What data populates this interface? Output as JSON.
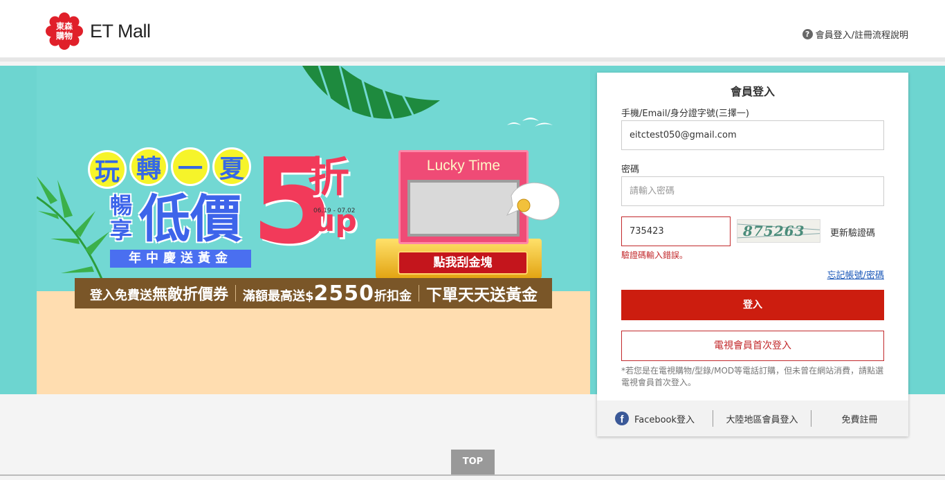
{
  "header": {
    "logo_badge": "東森購物",
    "logo_text": "ET Mall",
    "help_icon": "?",
    "help_link": "會員登入/註冊流程說明"
  },
  "banner": {
    "title_chars": [
      "玩",
      "轉",
      "一",
      "夏"
    ],
    "headline_1": "暢享",
    "headline_2": "低價",
    "headline_sub": "年中慶送黃金",
    "discount_big": "5",
    "discount_unit": "折",
    "discount_up": "up",
    "date_range": "06.19 - 07.02",
    "lucky_title": "Lucky Time",
    "scratch_button": "點我刮金塊",
    "promo_1_prefix": "登入免費送",
    "promo_1_main": "無敵折價券",
    "promo_2_prefix": "滿額最高送$",
    "promo_2_amount": "2550",
    "promo_2_suffix": "折扣金",
    "promo_3": "下單天天送黃金"
  },
  "login": {
    "title": "會員登入",
    "account_label": "手機/Email/身分證字號(三擇一)",
    "account_value": "eitctest050@gmail.com",
    "password_label": "密碼",
    "password_placeholder": "請輸入密碼",
    "captcha_value": "735423",
    "captcha_image_text": "875263",
    "refresh_captcha": "更新驗證碼",
    "error_message": "驗證碼輸入錯誤。",
    "forgot_link": "忘記帳號/密碼",
    "login_button": "登入",
    "tv_member_button": "電視會員首次登入",
    "note": "*若您是在電視購物/型錄/MOD等電話訂購，但未曾在網站消費，請點選電視會員首次登入。",
    "facebook_icon": "f",
    "facebook_login": "Facebook登入",
    "mainland_login": "大陸地區會員登入",
    "free_register": "免費註冊"
  },
  "top_button": "TOP",
  "colors": {
    "brand_red": "#cc1d0f",
    "banner_teal": "#6dd5d0",
    "error_red": "#c2282b",
    "link_blue": "#1a57b8"
  }
}
